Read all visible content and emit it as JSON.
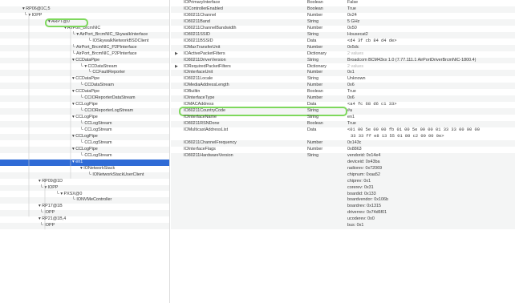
{
  "tree": {
    "rows": [
      {
        "label": "",
        "indent": 28
      },
      {
        "label": "▾ RP06@1C,5",
        "indent": 28
      },
      {
        "label": "└ ▾ IOPP",
        "indent": 30
      },
      {
        "label": "▾ ARPT@0",
        "indent": 60
      },
      {
        "label": "▾ AirPort_BrcmNIC",
        "indent": 80
      },
      {
        "label": "└ ▾ AirPort_BrcmNIC_SkywalkInterface",
        "indent": 90
      },
      {
        "label": "└ IOSkywalkNetworkBSDClient",
        "indent": 110
      },
      {
        "label": "└ AirPort_BrcmNIC_P2PInterface",
        "indent": 90
      },
      {
        "label": "└ AirPort_BrcmNIC_P2PInterface",
        "indent": 90
      },
      {
        "label": "▾ CCDataPipe",
        "indent": 90
      },
      {
        "label": "└ ▾ CCDataStream",
        "indent": 100
      },
      {
        "label": "└ CCFaultReporter",
        "indent": 110
      },
      {
        "label": "▾ CCDataPipe",
        "indent": 90
      },
      {
        "label": "└ CCDataStream",
        "indent": 100
      },
      {
        "label": "▾ CCDataPipe",
        "indent": 90
      },
      {
        "label": "└ CCIOReporterDataStream",
        "indent": 100
      },
      {
        "label": "▾ CCLogPipe",
        "indent": 90
      },
      {
        "label": "└ CCIOReporterLogStream",
        "indent": 100
      },
      {
        "label": "▾ CCLogPipe",
        "indent": 90
      },
      {
        "label": "└ CCLogStream",
        "indent": 100
      },
      {
        "label": "└ CCLogStream",
        "indent": 100
      },
      {
        "label": "▾ CCLogPipe",
        "indent": 90
      },
      {
        "label": "└ CCLogStream",
        "indent": 100
      },
      {
        "label": "▾ CCLogPipe",
        "indent": 90
      },
      {
        "label": "└ CCLogStream",
        "indent": 100
      },
      {
        "label": "▾ en1",
        "indent": 90
      },
      {
        "label": "▾ IONetworkStack",
        "indent": 100
      },
      {
        "label": "└ IONetworkStackUserClient",
        "indent": 110
      },
      {
        "label": "▾ RP09@1D",
        "indent": 48
      },
      {
        "label": "└ ▾ IOPP",
        "indent": 50
      },
      {
        "label": "└ ▾ PXSX@0",
        "indent": 70
      },
      {
        "label": "└ IONVMeController",
        "indent": 90
      },
      {
        "label": "▾ RP17@1B",
        "indent": 48
      },
      {
        "label": "└ IOPP",
        "indent": 50
      },
      {
        "label": "▾ RP21@1B,4",
        "indent": 48
      },
      {
        "label": "└ IOPP",
        "indent": 50
      }
    ],
    "selected_row": 25,
    "highlight_row": 3
  },
  "props": {
    "rows": [
      {
        "key": "IOPrimaryInterface",
        "type": "Boolean",
        "value": "False",
        "expand": false
      },
      {
        "key": "IOControllerEnabled",
        "type": "Boolean",
        "value": "True",
        "expand": false
      },
      {
        "key": "IO80211Channel",
        "type": "Number",
        "value": "0x24",
        "expand": false
      },
      {
        "key": "IO80211Band",
        "type": "String",
        "value": "5 GHz",
        "expand": false
      },
      {
        "key": "IO80211ChannelBandwidth",
        "type": "Number",
        "value": "0x50",
        "expand": false
      },
      {
        "key": "IO80211SSID",
        "type": "String",
        "value": "Housecat2",
        "expand": false
      },
      {
        "key": "IO80211BSSID",
        "type": "Data",
        "value": "<d4 3f cb 84 d4 de>",
        "expand": false,
        "mono": true
      },
      {
        "key": "IOMaxTransferUnit",
        "type": "Number",
        "value": "0x5dc",
        "expand": false
      },
      {
        "key": "IOActivePacketFilters",
        "type": "Dictionary",
        "value": "2 values",
        "expand": true,
        "muted": true
      },
      {
        "key": "IO80211DriverVersion",
        "type": "String",
        "value": "Broadcom BCM43xx 1.0 (7.77.111.1 AirPortDriverBrcmNIC-1800.4)",
        "expand": false
      },
      {
        "key": "IORequiredPacketFilters",
        "type": "Dictionary",
        "value": "2 values",
        "expand": true,
        "muted": true
      },
      {
        "key": "IOInterfaceUnit",
        "type": "Number",
        "value": "0x1",
        "expand": false
      },
      {
        "key": "IO80211Locale",
        "type": "String",
        "value": "Unknown",
        "expand": false
      },
      {
        "key": "IOMediaAddressLength",
        "type": "Number",
        "value": "0x6",
        "expand": false
      },
      {
        "key": "IOBuiltin",
        "type": "Boolean",
        "value": "True",
        "expand": false
      },
      {
        "key": "IOInterfaceType",
        "type": "Number",
        "value": "0x6",
        "expand": false
      },
      {
        "key": "IOMACAddress",
        "type": "Data",
        "value": "<a4 fc 68 d6 c1 33>",
        "expand": false,
        "mono": true
      },
      {
        "key": "IO80211CountryCode",
        "type": "String",
        "value": "#a",
        "expand": false
      },
      {
        "key": "IOInterfaceName",
        "type": "String",
        "value": "en1",
        "expand": false
      },
      {
        "key": "IO80211RSNDone",
        "type": "Boolean",
        "value": "True",
        "expand": false
      },
      {
        "key": "IOMulticastAddressList",
        "type": "Data",
        "value": "<01 00 5e 00 00 fb 01 00 5e 00 00 01 33 33 00 00 00",
        "value2": "33 33 ff e8 13 55 01 80 c2 00 00 0e>",
        "expand": false,
        "mono": true
      },
      {
        "key": "IO80211ChannelFrequency",
        "type": "Number",
        "value": "0x143c",
        "expand": false
      },
      {
        "key": "IOInterfaceFlags",
        "type": "Number",
        "value": "0x8863",
        "expand": false
      },
      {
        "key": "IO80211HardwareVersion",
        "type": "String",
        "value": "vendorid: 0x14e4",
        "expand": false,
        "extra": [
          "deviceid: 0x43ba",
          "radiorev: 0x72069",
          "chipnum: 0xaa52",
          "chiprev: 0x1",
          "corerev: 0x31",
          "boardid: 0x133",
          "boardvendor: 0x106b",
          "boardrev: 0x1315",
          "driverrev: 0x74d6f01",
          "ucoderev: 0x0",
          "bus: 0x1"
        ]
      }
    ],
    "highlight_key": "IO80211CountryCode"
  },
  "colors": {
    "selection": "#2f6bd6",
    "highlight_ring": "#7ed85c",
    "stripe": "#f4f5f5",
    "text": "#3a3a3a",
    "muted": "#b0b0b0"
  }
}
